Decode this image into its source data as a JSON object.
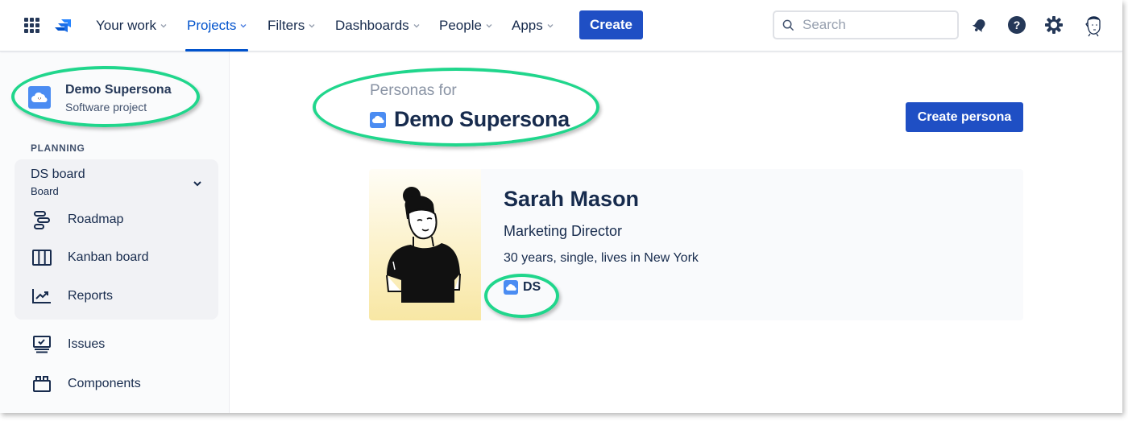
{
  "topnav": {
    "app_switcher_icon": "grid-icon",
    "logo_icon": "jira-logo-icon",
    "items": [
      {
        "label": "Your work",
        "active": false
      },
      {
        "label": "Projects",
        "active": true
      },
      {
        "label": "Filters",
        "active": false
      },
      {
        "label": "Dashboards",
        "active": false
      },
      {
        "label": "People",
        "active": false
      },
      {
        "label": "Apps",
        "active": false
      }
    ],
    "create_label": "Create",
    "search": {
      "placeholder": "Search",
      "value": ""
    },
    "icons": [
      "notifications-bell-icon",
      "help-icon",
      "settings-gear-icon",
      "user-avatar"
    ]
  },
  "sidebar": {
    "project": {
      "name": "Demo Supersona",
      "type": "Software project"
    },
    "section_label": "PLANNING",
    "board": {
      "name": "DS board",
      "sub": "Board"
    },
    "board_items": [
      {
        "label": "Roadmap",
        "icon": "roadmap-icon"
      },
      {
        "label": "Kanban board",
        "icon": "kanban-icon"
      },
      {
        "label": "Reports",
        "icon": "reports-icon"
      }
    ],
    "items": [
      {
        "label": "Issues",
        "icon": "issues-icon"
      },
      {
        "label": "Components",
        "icon": "components-icon"
      }
    ]
  },
  "main": {
    "header_label": "Personas for",
    "project_title": "Demo Supersona",
    "create_persona_label": "Create persona",
    "personas": [
      {
        "name": "Sarah Mason",
        "role": "Marketing Director",
        "description": "30 years, single, lives in New York",
        "project_key": "DS"
      }
    ]
  },
  "colors": {
    "brand_blue": "#1f4fc4",
    "active_nav": "#0052cc",
    "annotation_green": "#20d68c",
    "text_primary": "#172b4d"
  }
}
